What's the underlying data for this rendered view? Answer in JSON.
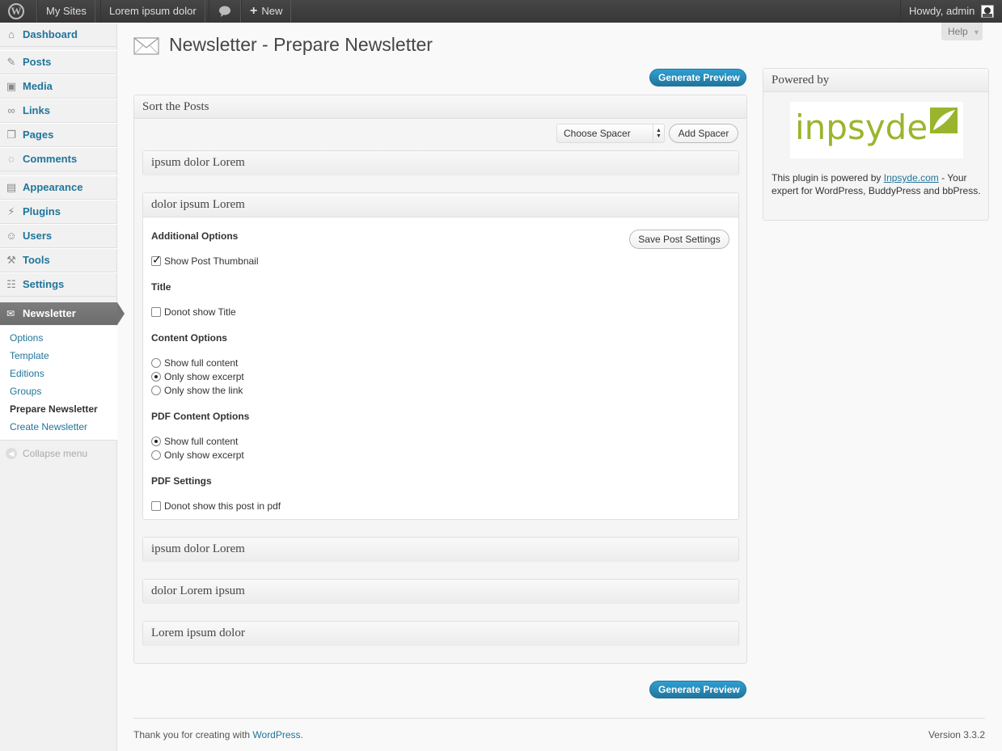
{
  "admin_bar": {
    "my_sites": "My Sites",
    "site_name": "Lorem ipsum dolor",
    "new": "New",
    "howdy": "Howdy, admin"
  },
  "sidebar": {
    "items": [
      {
        "label": "Dashboard",
        "icon": "dashboard-icon"
      },
      {
        "label": "Posts",
        "icon": "pin-icon"
      },
      {
        "label": "Media",
        "icon": "media-icon"
      },
      {
        "label": "Links",
        "icon": "link-icon"
      },
      {
        "label": "Pages",
        "icon": "page-icon"
      },
      {
        "label": "Comments",
        "icon": "comment-icon"
      },
      {
        "label": "Appearance",
        "icon": "appearance-icon"
      },
      {
        "label": "Plugins",
        "icon": "plug-icon"
      },
      {
        "label": "Users",
        "icon": "users-icon"
      },
      {
        "label": "Tools",
        "icon": "tools-icon"
      },
      {
        "label": "Settings",
        "icon": "settings-icon"
      }
    ],
    "newsletter": "Newsletter",
    "submenu": [
      "Options",
      "Template",
      "Editions",
      "Groups",
      "Prepare Newsletter",
      "Create Newsletter"
    ],
    "current_submenu": "Prepare Newsletter",
    "collapse": "Collapse menu"
  },
  "help": "Help",
  "page_title": "Newsletter - Prepare Newsletter",
  "generate_preview": "Generate Preview",
  "sort_box": {
    "title": "Sort the Posts",
    "spacer_select": "Choose Spacer",
    "add_spacer": "Add Spacer",
    "posts": [
      {
        "title": "ipsum dolor Lorem"
      },
      {
        "title": "dolor ipsum Lorem"
      },
      {
        "title": "ipsum dolor Lorem"
      },
      {
        "title": "dolor Lorem ipsum"
      },
      {
        "title": "Lorem ipsum dolor"
      }
    ],
    "open_post": {
      "additional_options": "Additional Options",
      "save_button": "Save Post Settings",
      "show_thumbnail": "Show Post Thumbnail",
      "show_thumbnail_checked": true,
      "title_heading": "Title",
      "donot_show_title": "Donot show Title",
      "donot_show_title_checked": false,
      "content_options": "Content Options",
      "content_choices": [
        "Show full content",
        "Only show excerpt",
        "Only show the link"
      ],
      "content_selected": "Only show excerpt",
      "pdf_content_options": "PDF Content Options",
      "pdf_content_choices": [
        "Show full content",
        "Only show excerpt"
      ],
      "pdf_content_selected": "Show full content",
      "pdf_settings": "PDF Settings",
      "donot_show_pdf": "Donot show this post in pdf",
      "donot_show_pdf_checked": false
    }
  },
  "powered_box": {
    "title": "Powered by",
    "logo_text": "inpsyde",
    "logo_color": "#9ab52d",
    "text_before": "This plugin is powered by ",
    "link": "Inpsyde.com",
    "text_after": " - Your expert for WordPress, BuddyPress and bbPress."
  },
  "footer": {
    "thanks": "Thank you for creating with ",
    "wordpress_link": "WordPress",
    "period": ".",
    "version": "Version 3.3.2"
  },
  "colors": {
    "accent": "#21759b",
    "admin_bar": "#464646"
  }
}
